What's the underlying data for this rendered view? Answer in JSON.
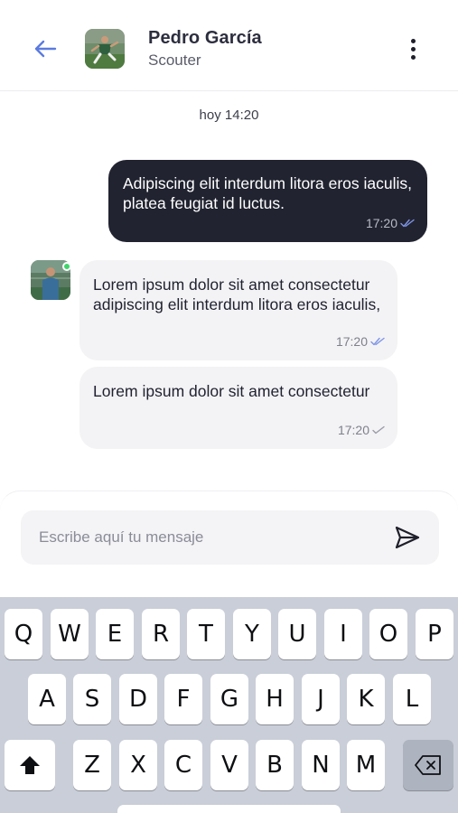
{
  "header": {
    "back_icon": "arrow-left-icon",
    "name": "Pedro García",
    "role": "Scouter",
    "more_icon": "more-vertical-icon"
  },
  "date_separator": "hoy 14:20",
  "messages": [
    {
      "direction": "outgoing",
      "text": "Adipiscing elit interdum litora eros iaculis, platea feugiat id luctus.",
      "time": "17:20",
      "status": "read"
    },
    {
      "direction": "incoming",
      "text": "Lorem ipsum dolor sit amet consectetur adipiscing elit interdum litora eros iaculis,",
      "time": "17:20",
      "status": "read"
    },
    {
      "direction": "incoming",
      "text": "Lorem ipsum dolor sit amet consectetur",
      "time": "17:20",
      "status": "sent"
    }
  ],
  "composer": {
    "placeholder": "Escribe aquí tu mensaje",
    "send_icon": "send-icon"
  },
  "keyboard": {
    "row1": [
      "Q",
      "W",
      "E",
      "R",
      "T",
      "Y",
      "U",
      "I",
      "O",
      "P"
    ],
    "row2": [
      "A",
      "S",
      "D",
      "F",
      "G",
      "H",
      "J",
      "K",
      "L"
    ],
    "row3": [
      "Z",
      "X",
      "C",
      "V",
      "B",
      "N",
      "M"
    ],
    "shift_icon": "shift-icon",
    "backspace_icon": "backspace-icon"
  },
  "colors": {
    "accent": "#5b7be0",
    "outgoing_bubble": "#212330",
    "incoming_bubble": "#f3f3f5",
    "online": "#3fd46b",
    "keyboard_bg": "#c9ced8"
  }
}
